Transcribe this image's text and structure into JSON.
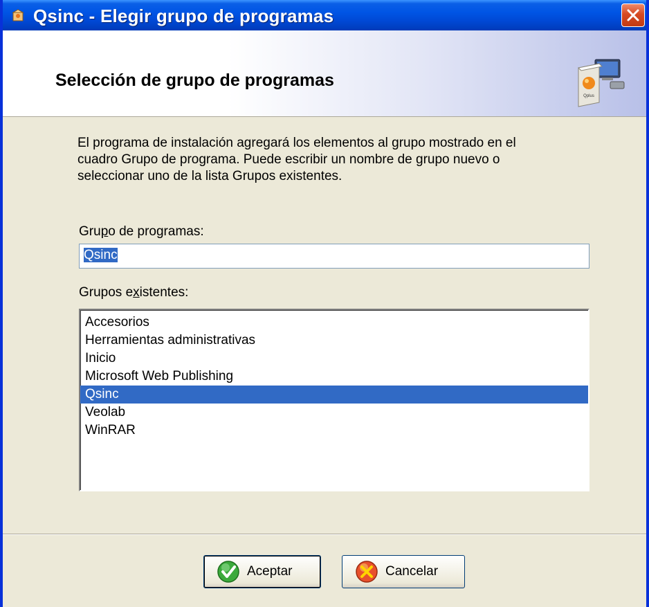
{
  "window": {
    "title": "Qsinc - Elegir grupo de programas"
  },
  "header": {
    "title": "Selección de grupo de programas",
    "icon_label": "Qplus"
  },
  "description": {
    "line1": "El programa de instalación agregará los elementos al grupo mostrado en el",
    "line2": "cuadro Grupo de programa. Puede escribir un nombre de grupo nuevo o",
    "line3": "seleccionar uno de la lista Grupos existentes."
  },
  "group_field": {
    "label_pre": "Gru",
    "label_key": "p",
    "label_post": "o de programas:",
    "value": "Qsinc"
  },
  "existing_groups": {
    "label_pre": "Grupos e",
    "label_key": "x",
    "label_post": "istentes:",
    "items": [
      "Accesorios",
      "Herramientas administrativas",
      "Inicio",
      "Microsoft Web Publishing",
      "Qsinc",
      "Veolab",
      "WinRAR"
    ],
    "selected": "Qsinc"
  },
  "buttons": {
    "accept": "Aceptar",
    "cancel": "Cancelar"
  },
  "colors": {
    "titlebar": "#0054e3",
    "selection": "#316ac5",
    "dialog_bg": "#ece9d8",
    "close_button": "#d64a22"
  }
}
